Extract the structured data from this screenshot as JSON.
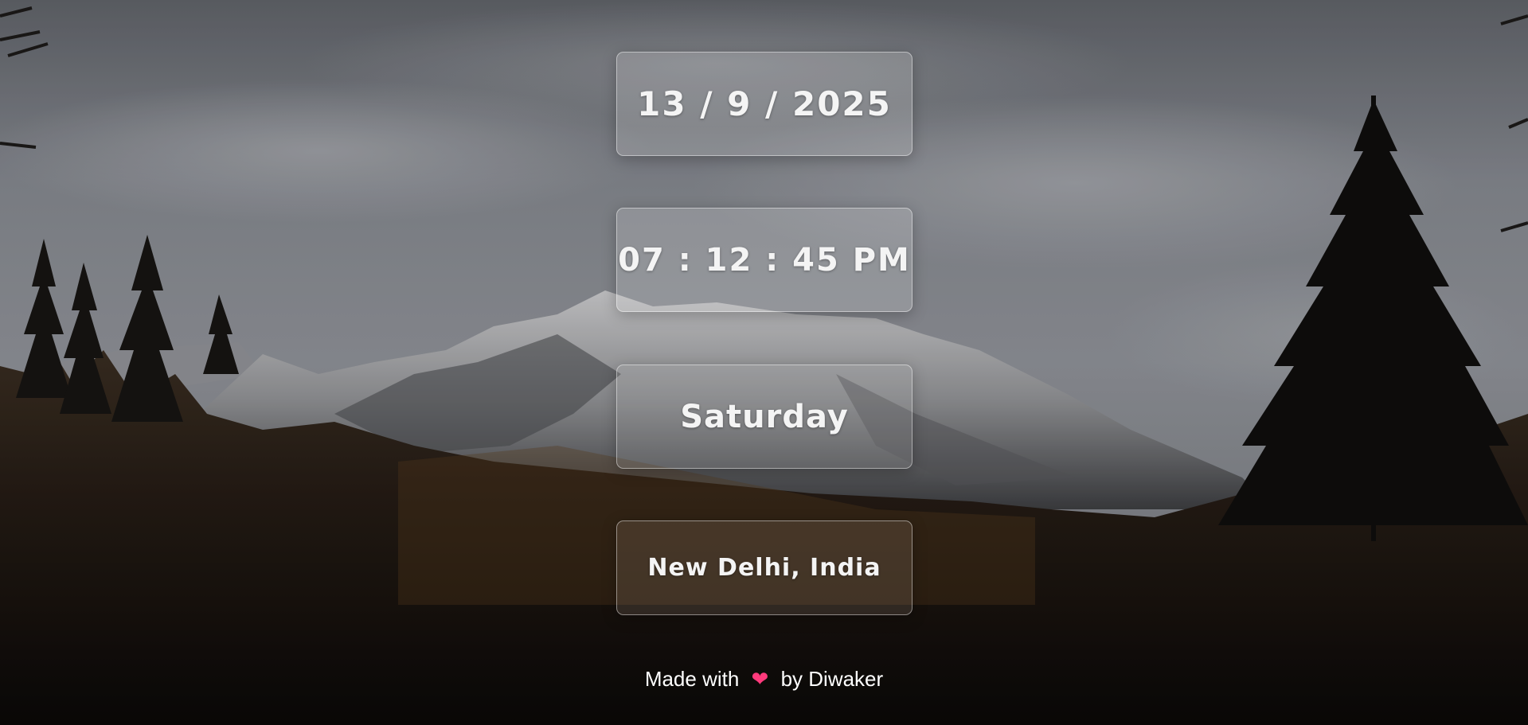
{
  "clock": {
    "date": "13 / 9 / 2025",
    "time": "07 : 12 : 45 PM",
    "day": "Saturday",
    "location": "New Delhi, India"
  },
  "footer": {
    "prefix": "Made with",
    "heart_icon": "heart-icon",
    "heart_glyph": "❤",
    "suffix": "by Diwaker"
  },
  "colors": {
    "panel_text": "#f4f4f4",
    "heart": "#ff3a7c"
  },
  "background": {
    "scene": "cloudy mountain landscape with pine forest"
  }
}
